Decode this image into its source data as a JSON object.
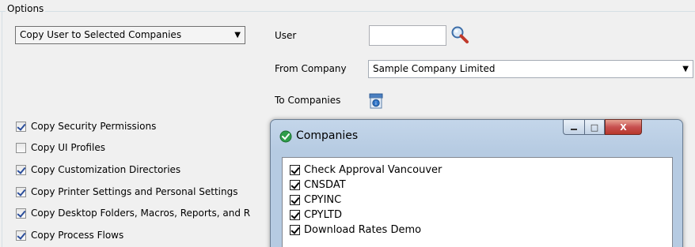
{
  "options": {
    "legend": "Options",
    "operation_combo": {
      "value": "Copy User to Selected Companies",
      "arrow": "▼"
    }
  },
  "fields": {
    "user_label": "User",
    "user_value": "",
    "from_company_label": "From Company",
    "from_company_value": "Sample Company Limited",
    "to_companies_label": "To Companies"
  },
  "copy_options": [
    {
      "label": "Copy Security Permissions",
      "checked": true
    },
    {
      "label": "Copy UI Profiles",
      "checked": false
    },
    {
      "label": "Copy Customization Directories",
      "checked": true
    },
    {
      "label": "Copy Printer Settings and Personal Settings",
      "checked": true
    },
    {
      "label": "Copy Desktop Folders, Macros, Reports, and R",
      "checked": true
    },
    {
      "label": "Copy Process Flows",
      "checked": true
    }
  ],
  "dialog": {
    "title": "Companies",
    "max_glyph": "□",
    "close_glyph": "X",
    "companies": [
      {
        "label": "Check Approval Vancouver",
        "checked": true
      },
      {
        "label": "CNSDAT",
        "checked": true
      },
      {
        "label": "CPYINC",
        "checked": true
      },
      {
        "label": "CPYLTD",
        "checked": true
      },
      {
        "label": "Download Rates Demo",
        "checked": true
      }
    ]
  },
  "icons": {
    "search": "magnifier-icon",
    "finder": "company-finder-icon",
    "app": "sage-app-icon"
  },
  "colors": {
    "window_bg": "#f0f0f0",
    "dialog_frame": "#b6cbe2",
    "close_button": "#c75050",
    "checkmark": "#2a4d9b"
  }
}
